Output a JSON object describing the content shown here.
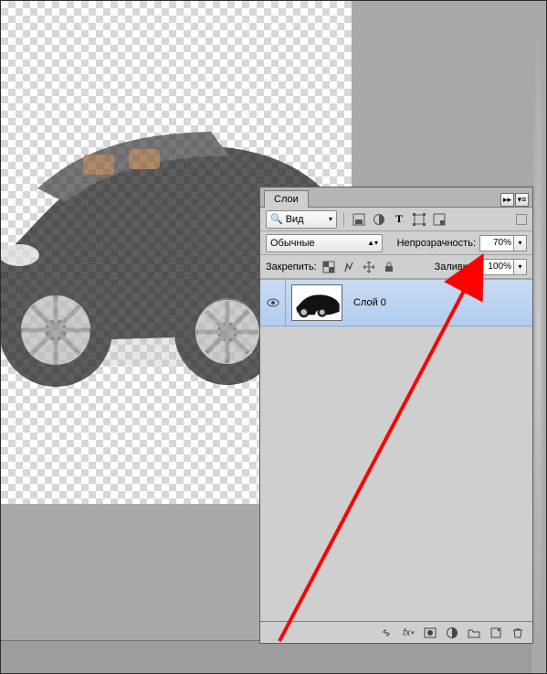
{
  "panel": {
    "tab": "Слои",
    "filter": {
      "label": "Вид"
    },
    "blend_mode": {
      "value": "Обычные"
    },
    "opacity": {
      "label": "Непрозрачность:",
      "value": "70%"
    },
    "lock_label": "Закрепить:",
    "fill": {
      "label": "Заливка:",
      "value": "100%"
    },
    "layer0": {
      "name": "Слой 0"
    }
  },
  "icons": {
    "search": "search-icon",
    "menu_rows": "menu-rows-icon",
    "img_filter": "image-filter-icon",
    "adjust": "adjustments-icon",
    "type": "text-icon",
    "shape": "shape-icon",
    "smartobj": "smart-object-icon",
    "lock_pixels": "lock-pixels-icon",
    "lock_brush": "lock-brush-icon",
    "lock_move": "lock-move-icon",
    "lock_all": "lock-all-icon",
    "eye": "visibility-icon",
    "link": "link-icon",
    "fx": "fx-icon",
    "mask": "mask-icon",
    "adjust2": "adjustment-layer-icon",
    "group": "group-icon",
    "new": "new-layer-icon",
    "trash": "trash-icon"
  }
}
